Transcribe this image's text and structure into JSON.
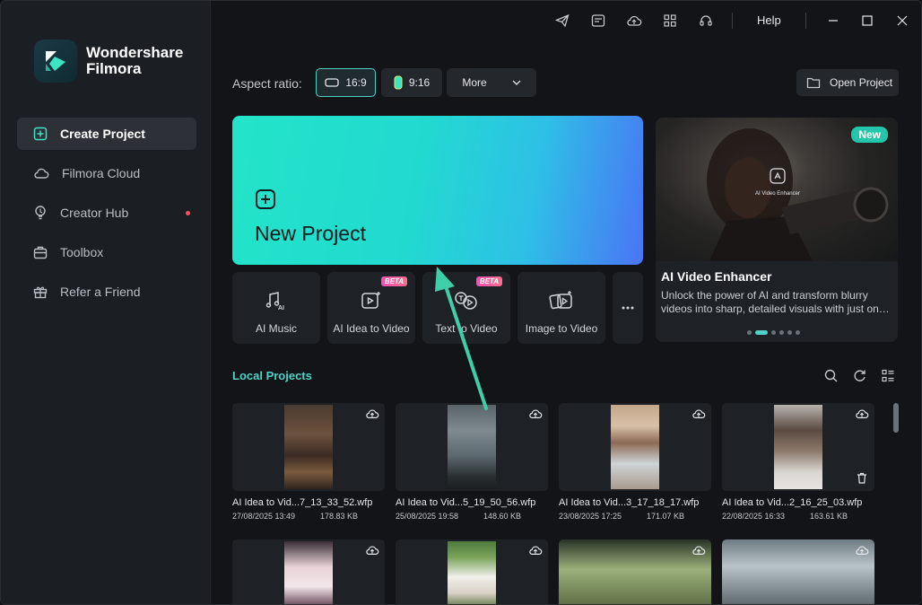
{
  "brand": {
    "line1": "Wondershare",
    "line2": "Filmora"
  },
  "sidebar": {
    "items": [
      {
        "label": "Create Project",
        "icon": "plus-square-icon",
        "active": true
      },
      {
        "label": "Filmora Cloud",
        "icon": "cloud-icon"
      },
      {
        "label": "Creator Hub",
        "icon": "lightbulb-icon",
        "dot": true
      },
      {
        "label": "Toolbox",
        "icon": "toolbox-icon"
      },
      {
        "label": "Refer a Friend",
        "icon": "gift-icon"
      }
    ]
  },
  "titlebar": {
    "help": "Help"
  },
  "aspect": {
    "label": "Aspect ratio:",
    "options": [
      "16:9",
      "9:16"
    ],
    "more": "More",
    "open_project": "Open Project"
  },
  "new_project": {
    "label": "New Project"
  },
  "tools": [
    {
      "label": "AI Music",
      "beta": ""
    },
    {
      "label": "AI Idea to Video",
      "beta": "BETA"
    },
    {
      "label": "Text to Video",
      "beta": "BETA"
    },
    {
      "label": "Image to Video",
      "beta": ""
    }
  ],
  "promo": {
    "badge": "New",
    "center_label": "AI Video Enhancer",
    "title": "AI Video Enhancer",
    "desc": "Unlock the power of AI and transform blurry videos into sharp, detailed visuals with just on…"
  },
  "local_projects": {
    "title": "Local Projects",
    "cards": [
      {
        "name": "AI Idea to Vid...7_13_33_52.wfp",
        "date": "27/08/2025 13:49",
        "size": "178.83 KB"
      },
      {
        "name": "AI Idea to Vid...5_19_50_56.wfp",
        "date": "25/08/2025 19:58",
        "size": "148.60 KB"
      },
      {
        "name": "AI Idea to Vid...3_17_18_17.wfp",
        "date": "23/08/2025 17:25",
        "size": "171.07 KB"
      },
      {
        "name": "AI Idea to Vid...2_16_25_03.wfp",
        "date": "22/08/2025 16:33",
        "size": "163.61 KB"
      }
    ]
  },
  "colors": {
    "accent": "#4fd1c5",
    "arrow": "#3ecfa8"
  }
}
